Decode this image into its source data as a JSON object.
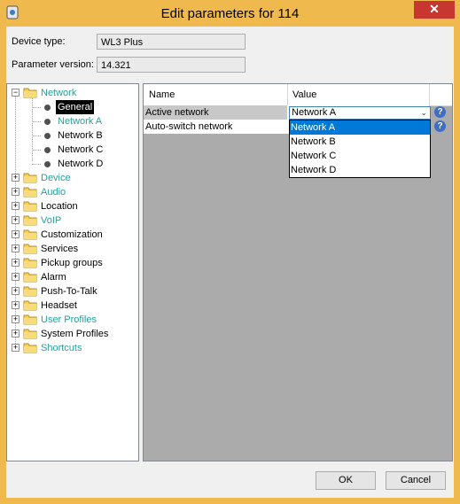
{
  "window": {
    "title": "Edit parameters for 114",
    "close_glyph": "✕",
    "icon": "app-icon"
  },
  "form": {
    "device_type_label": "Device type:",
    "device_type_value": "WL3 Plus",
    "param_version_label": "Parameter version:",
    "param_version_value": "14.321"
  },
  "tree": {
    "root": {
      "label": "Network",
      "expander": "−"
    },
    "children": [
      {
        "label": "General",
        "selected": true
      },
      {
        "label": "Network A",
        "teal": true
      },
      {
        "label": "Network B"
      },
      {
        "label": "Network C"
      },
      {
        "label": "Network D"
      }
    ],
    "folders": [
      {
        "label": "Device",
        "teal": true
      },
      {
        "label": "Audio",
        "teal": true
      },
      {
        "label": "Location"
      },
      {
        "label": "VoIP",
        "teal": true
      },
      {
        "label": "Customization"
      },
      {
        "label": "Services"
      },
      {
        "label": "Pickup groups"
      },
      {
        "label": "Alarm"
      },
      {
        "label": "Push-To-Talk"
      },
      {
        "label": "Headset"
      },
      {
        "label": "User Profiles",
        "teal": true
      },
      {
        "label": "System Profiles"
      },
      {
        "label": "Shortcuts",
        "teal": true
      }
    ],
    "expand_glyph": "+"
  },
  "grid": {
    "col_name": "Name",
    "col_value": "Value",
    "rows": [
      {
        "name": "Active network",
        "value": "Network A"
      },
      {
        "name": "Auto-switch network",
        "value": ""
      }
    ],
    "help_glyph": "?",
    "combo_arrow": "⌄",
    "dropdown_options": [
      "Network A",
      "Network B",
      "Network C",
      "Network D"
    ],
    "dropdown_selected": "Network A"
  },
  "buttons": {
    "ok": "OK",
    "cancel": "Cancel"
  },
  "colors": {
    "title_bar": "#f0b94e",
    "selection": "#0078d7",
    "teal_text": "#2a9d9b"
  }
}
